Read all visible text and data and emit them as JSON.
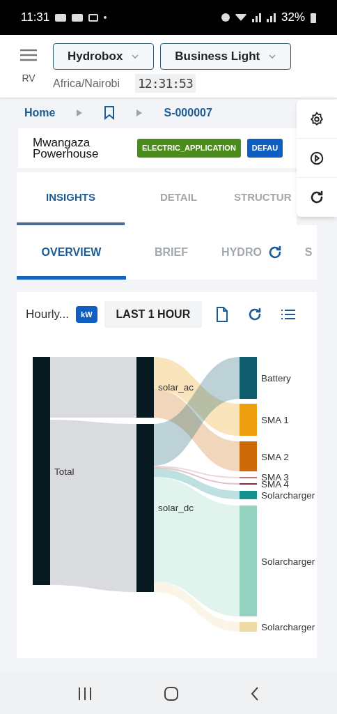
{
  "status_bar": {
    "time": "11:31",
    "battery": "32%"
  },
  "header": {
    "user": "RV",
    "selectors": [
      {
        "label": "Hydrobox"
      },
      {
        "label": "Business Light"
      }
    ],
    "timezone": "Africa/Nairobi",
    "clock": "12:31:53"
  },
  "breadcrumb": {
    "items": [
      {
        "kind": "text",
        "label": "Home"
      },
      {
        "kind": "bookmark"
      },
      {
        "kind": "text",
        "label": "S-000007"
      }
    ]
  },
  "site": {
    "name": "Mwangaza Powerhouse",
    "tags": [
      {
        "label": "ELECTRIC_APPLICATION",
        "color": "#4a8c1c"
      },
      {
        "label": "DEFAU",
        "color": "#0f5ec2"
      }
    ]
  },
  "tabs": [
    {
      "label": "INSIGHTS",
      "selected": true
    },
    {
      "label": "DETAIL",
      "selected": false
    },
    {
      "label": "STRUCTUR",
      "selected": false
    }
  ],
  "subtabs": [
    {
      "label": "OVERVIEW",
      "selected": true
    },
    {
      "label": "BRIEF",
      "selected": false
    },
    {
      "label": "HYDRO",
      "selected": false
    },
    {
      "label": "S",
      "selected": false
    }
  ],
  "chart_card": {
    "title": "Hourly...",
    "unit": "kW",
    "range": "LAST 1 HOUR"
  },
  "sankey": {
    "nodes": [
      {
        "label": "Total",
        "color": "#061a20"
      },
      {
        "label": "solar_ac",
        "color": "#061a20"
      },
      {
        "label": "solar_dc",
        "color": "#061a20"
      },
      {
        "label": "Battery",
        "color": "#0e5c6e"
      },
      {
        "label": "SMA 1",
        "color": "#ee9f10"
      },
      {
        "label": "SMA 2",
        "color": "#cd6a0a"
      },
      {
        "label": "SMA 3",
        "color": "#c0707a"
      },
      {
        "label": "SMA 4",
        "color": "#8a2a3a"
      },
      {
        "label": "Solarcharger",
        "color": "#16918e"
      },
      {
        "label": "Solarcharger",
        "color": "#94d3bf"
      },
      {
        "label": "Solarcharger",
        "color": "#ecdba4"
      }
    ]
  }
}
